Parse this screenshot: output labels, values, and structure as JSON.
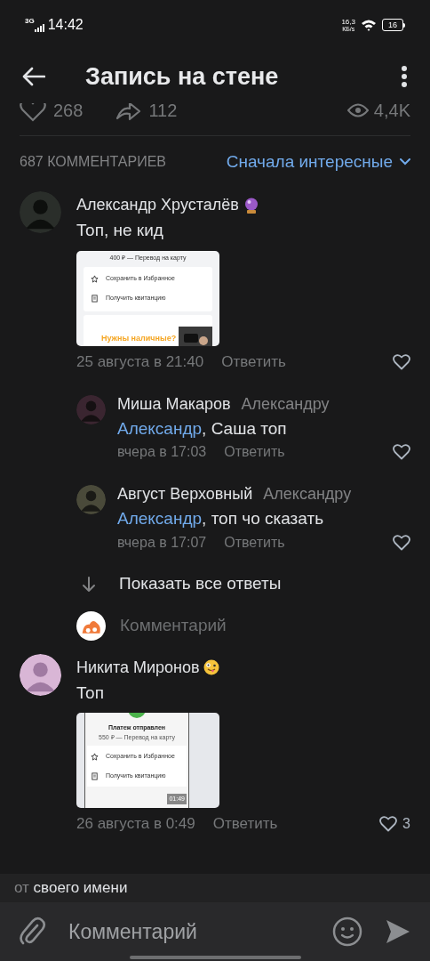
{
  "status_bar": {
    "network": "3G",
    "time": "14:42",
    "speed": "16,3",
    "speed_unit": "КБ/s",
    "battery": "16"
  },
  "header": {
    "title": "Запись на стене"
  },
  "stats": {
    "likes": "268",
    "reposts": "112",
    "views": "4,4K"
  },
  "comments_header": {
    "count": "687 КОММЕНТАРИЕВ",
    "sort": "Сначала интересные"
  },
  "comments": [
    {
      "author": "Александр Хрусталёв",
      "kind": "crystal_ball",
      "text": "Топ, не кид",
      "attachment": {
        "kind": "transfer",
        "title": "400 ₽ — Перевод на карту",
        "items": [
          "Сохранить в Избранное",
          "Получить квитанцию"
        ],
        "banner": "Нужны наличные?"
      },
      "date": "25 августа в 21:40",
      "reply": "Ответить",
      "replies": [
        {
          "author": "Миша Макаров",
          "reply_to": "Александру",
          "mention": "Александр",
          "text": ", Саша топ",
          "date": "вчера в 17:03",
          "reply": "Ответить"
        },
        {
          "author": "Август Верховный",
          "reply_to": "Александру",
          "mention": "Александр",
          "text": ", топ чо сказать",
          "date": "вчера в 17:07",
          "reply": "Ответить"
        }
      ],
      "show_all": "Показать все ответы",
      "reply_field": {
        "placeholder": "Комментарий"
      }
    },
    {
      "author": "Никита Миронов",
      "kind": "silly_face",
      "text": "Топ",
      "attachment": {
        "kind": "payment_video",
        "heading": "Платеж отправлен",
        "title": "550 ₽ — Перевод на карту",
        "items": [
          "Сохранить в Избранное",
          "Получить квитанцию"
        ],
        "duration": "01:49"
      },
      "date": "26 августа в 0:49",
      "reply": "Ответить",
      "likes": "3"
    }
  ],
  "footer": {
    "identity_prefix": "от",
    "identity": "своего имени",
    "placeholder": "Комментарий"
  }
}
